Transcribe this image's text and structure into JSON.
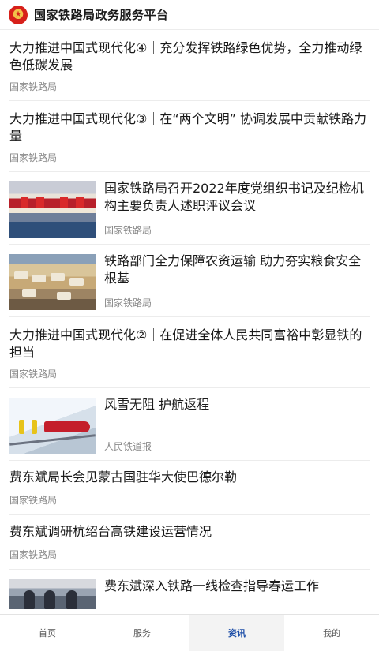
{
  "header": {
    "title": "国家铁路局政务服务平台",
    "emblem_icon": "national-emblem-icon"
  },
  "feed": {
    "items": [
      {
        "title": "大力推进中国式现代化④｜充分发挥铁路绿色优势，全力推动绿色低碳发展",
        "source": "国家铁路局"
      },
      {
        "title": "大力推进中国式现代化③｜在“两个文明” 协调发展中贡献铁路力量",
        "source": "国家铁路局"
      },
      {
        "title": "国家铁路局召开2022年度党组织书记及纪检机构主要负责人述职评议会议",
        "source": "国家铁路局"
      },
      {
        "title": "铁路部门全力保障农资运输 助力夯实粮食安全根基",
        "source": "国家铁路局"
      },
      {
        "title": "大力推进中国式现代化②｜在促进全体人民共同富裕中彰显铁的担当",
        "source": "国家铁路局"
      },
      {
        "title": "风雪无阻 护航返程",
        "source": "人民铁道报"
      },
      {
        "title": "费东斌局长会见蒙古国驻华大使巴德尔勒",
        "source": "国家铁路局"
      },
      {
        "title": "费东斌调研杭绍台高铁建设运营情况",
        "source": "国家铁路局"
      },
      {
        "title": "费东斌深入铁路一线检查指导春运工作"
      }
    ]
  },
  "tabbar": {
    "tabs": [
      {
        "label": "首页"
      },
      {
        "label": "服务"
      },
      {
        "label": "资讯"
      },
      {
        "label": "我的"
      }
    ],
    "active_color": "#1e4fa8"
  }
}
